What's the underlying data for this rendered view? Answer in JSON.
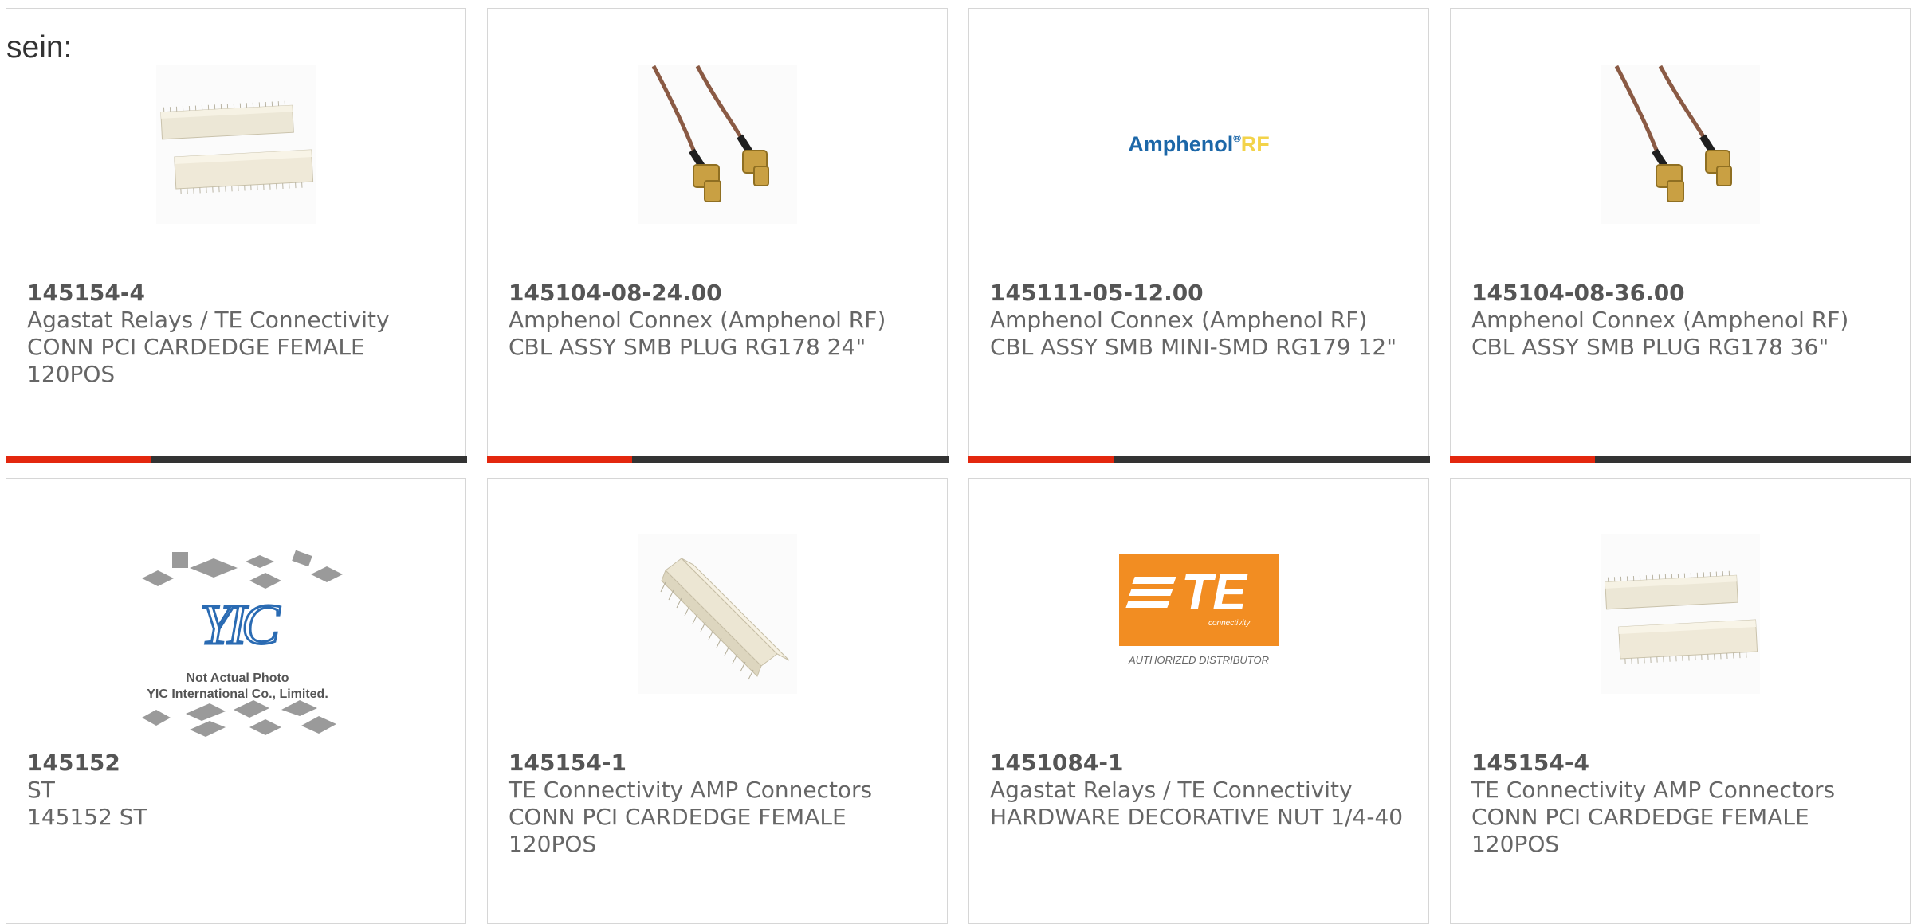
{
  "intro_text": "sein:",
  "colors": {
    "accent": "#e3270e",
    "stripe_dark": "#333333",
    "border": "#d6d6d6",
    "text": "#666666"
  },
  "products": [
    {
      "part_number": "145154-4",
      "manufacturer": "Agastat Relays / TE Connectivity",
      "description": "CONN PCI CARDEDGE FEMALE 120POS",
      "image": "card-edge-connector-pair"
    },
    {
      "part_number": "145104-08-24.00",
      "manufacturer": "Amphenol Connex (Amphenol RF)",
      "description": "CBL ASSY SMB PLUG RG178 24\"",
      "image": "rf-cable-assembly"
    },
    {
      "part_number": "145111-05-12.00",
      "manufacturer": "Amphenol Connex (Amphenol RF)",
      "description": "CBL ASSY SMB MINI-SMD RG179 12\"",
      "image": "amphenol-rf-logo",
      "logo_text": "Amphenol",
      "logo_suffix": "RF"
    },
    {
      "part_number": "145104-08-36.00",
      "manufacturer": "Amphenol Connex (Amphenol RF)",
      "description": "CBL ASSY SMB PLUG RG178 36\"",
      "image": "rf-cable-assembly"
    },
    {
      "part_number": "145152",
      "manufacturer": "ST",
      "description": "145152 ST",
      "image": "yic-placeholder",
      "placeholder_line1": "Not Actual Photo",
      "placeholder_line2": "YIC International Co., Limited.",
      "placeholder_logo": "YIC"
    },
    {
      "part_number": "145154-1",
      "manufacturer": "TE Connectivity AMP Connectors",
      "description": "CONN PCI CARDEDGE FEMALE 120POS",
      "image": "card-edge-connector-single"
    },
    {
      "part_number": "1451084-1",
      "manufacturer": "Agastat Relays / TE Connectivity",
      "description": "HARDWARE DECORATIVE NUT 1/4-40",
      "image": "te-logo",
      "logo_text": "TE",
      "logo_sub": "connectivity",
      "logo_caption": "AUTHORIZED DISTRIBUTOR"
    },
    {
      "part_number": "145154-4",
      "manufacturer": "TE Connectivity AMP Connectors",
      "description": "CONN PCI CARDEDGE FEMALE 120POS",
      "image": "card-edge-connector-pair"
    }
  ]
}
